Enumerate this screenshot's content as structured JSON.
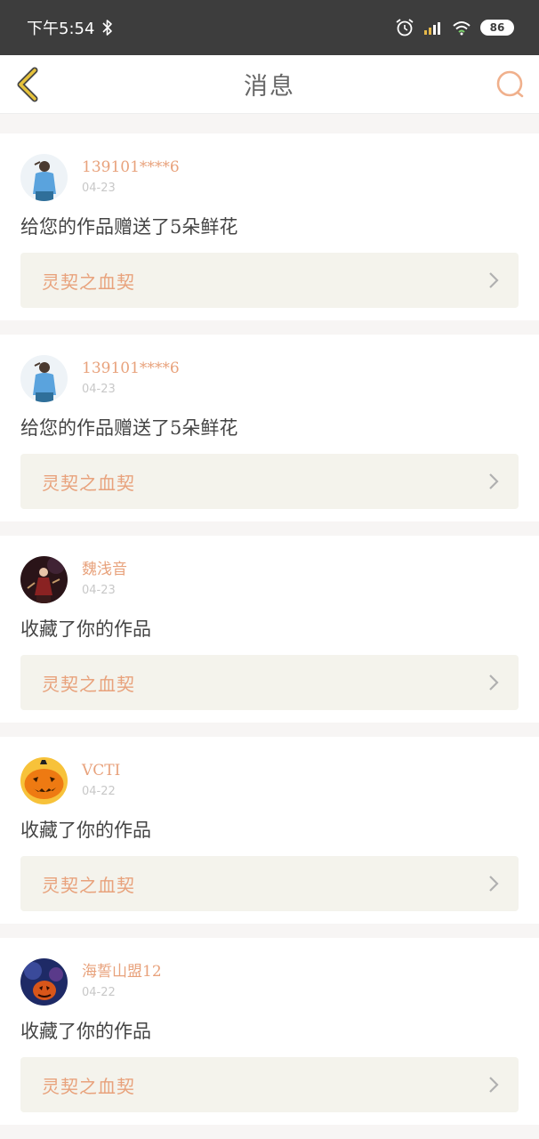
{
  "status": {
    "time": "下午5:54",
    "battery": "86"
  },
  "header": {
    "title": "消息"
  },
  "messages": [
    {
      "user": "139101****6",
      "date": "04-23",
      "text": "给您的作品赠送了5朵鲜花",
      "work": "灵契之血契",
      "avatar": "avatar-girl-icon"
    },
    {
      "user": "139101****6",
      "date": "04-23",
      "text": "给您的作品赠送了5朵鲜花",
      "work": "灵契之血契",
      "avatar": "avatar-girl-icon"
    },
    {
      "user": "魏浅音",
      "date": "04-23",
      "text": "收藏了你的作品",
      "work": "灵契之血契",
      "avatar": "avatar-dark-figure-icon"
    },
    {
      "user": "VCTI",
      "date": "04-22",
      "text": "收藏了你的作品",
      "work": "灵契之血契",
      "avatar": "avatar-pumpkin-icon"
    },
    {
      "user": "海誓山盟12",
      "date": "04-22",
      "text": "收藏了你的作品",
      "work": "灵契之血契",
      "avatar": "avatar-blue-night-icon"
    }
  ],
  "colors": {
    "accent": "#e8a27c",
    "back_icon": "#e6c23b",
    "link_bg": "#f4f3ec",
    "status_bar": "#3d3d3d"
  }
}
